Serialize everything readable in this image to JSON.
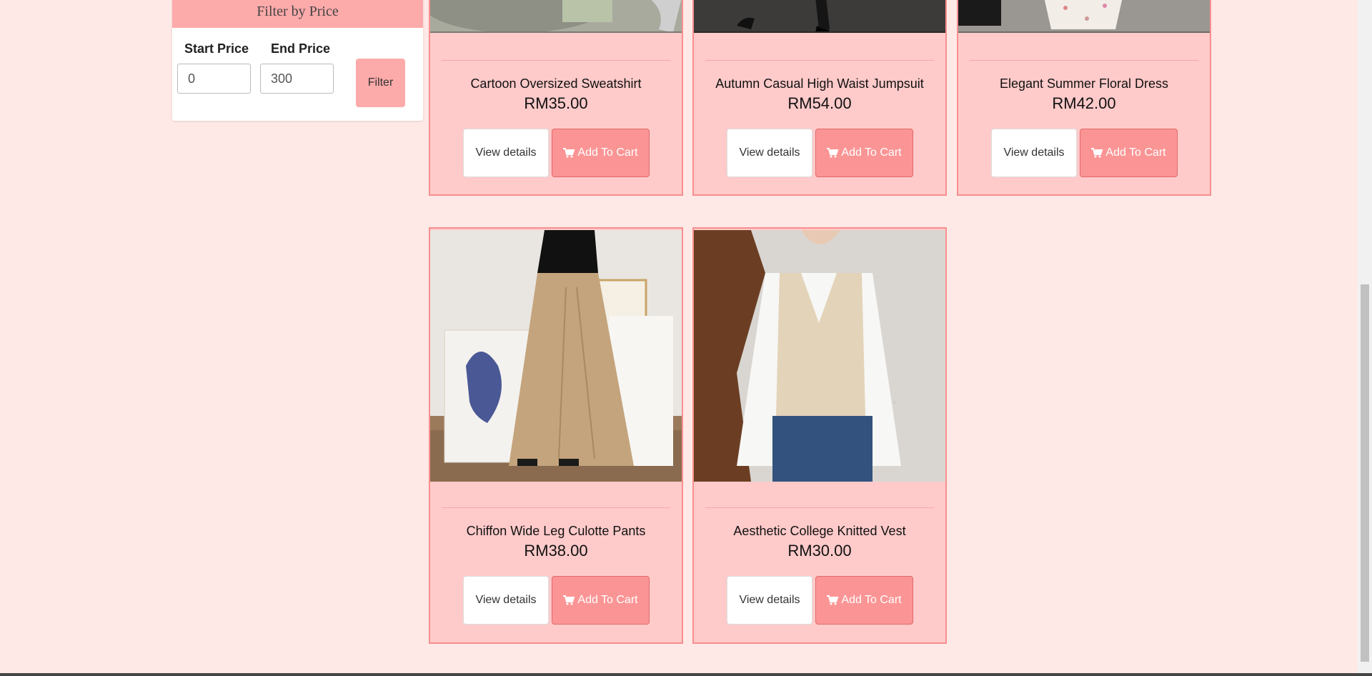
{
  "filter": {
    "title": "Filter by Price",
    "start_label": "Start Price",
    "end_label": "End Price",
    "start_value": "0",
    "end_value": "300",
    "button_label": "Filter"
  },
  "products": [
    {
      "name": "Cartoon Oversized Sweatshirt",
      "price": "RM35.00",
      "details_label": "View details",
      "cart_label": "Add To Cart"
    },
    {
      "name": "Autumn Casual High Waist Jumpsuit",
      "price": "RM54.00",
      "details_label": "View details",
      "cart_label": "Add To Cart"
    },
    {
      "name": "Elegant Summer Floral Dress",
      "price": "RM42.00",
      "details_label": "View details",
      "cart_label": "Add To Cart"
    },
    {
      "name": "Chiffon Wide Leg Culotte Pants",
      "price": "RM38.00",
      "details_label": "View details",
      "cart_label": "Add To Cart"
    },
    {
      "name": "Aesthetic College Knitted Vest",
      "price": "RM30.00",
      "details_label": "View details",
      "cart_label": "Add To Cart"
    }
  ],
  "icons": {
    "cart": "shopping-cart-icon"
  },
  "colors": {
    "background": "#ffe9e7",
    "card": "#ffcaca",
    "card_border": "#f88f8f",
    "accent": "#fb9595",
    "filter_header": "#fdaaaa"
  }
}
